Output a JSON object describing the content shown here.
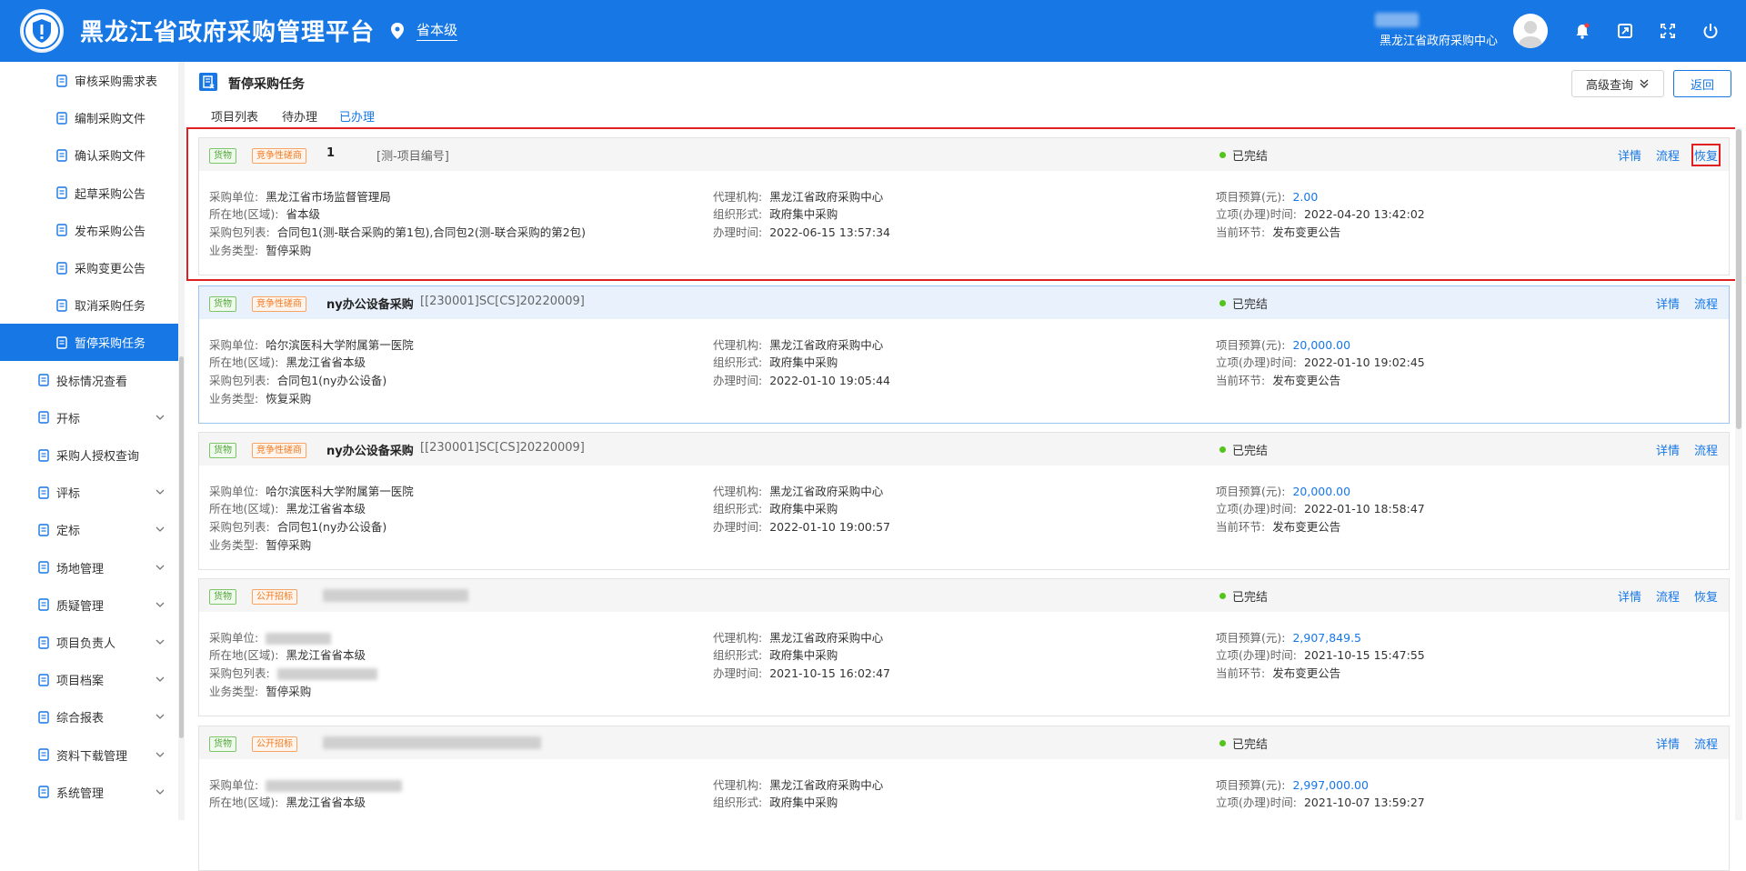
{
  "header": {
    "title": "黑龙江省政府采购管理平台",
    "location": "省本级",
    "user_name": "黑龙江省政府采购中心"
  },
  "colors": {
    "primary": "#1677e5",
    "green": "#52c41a",
    "orange": "#f27a21",
    "highlight": "#e02020"
  },
  "sidebar": {
    "items": [
      {
        "label": "审核采购需求表",
        "icon": "clipboard-check-icon"
      },
      {
        "label": "编制采购文件",
        "icon": "document-icon"
      },
      {
        "label": "确认采购文件",
        "icon": "document-check-icon"
      },
      {
        "label": "起草采购公告",
        "icon": "cart-icon"
      },
      {
        "label": "发布采购公告",
        "icon": "users-icon"
      },
      {
        "label": "采购变更公告",
        "icon": "document-list-icon"
      },
      {
        "label": "取消采购任务",
        "icon": "document-cancel-icon"
      },
      {
        "label": "暂停采购任务",
        "icon": "document-pause-icon"
      },
      {
        "label": "投标情况查看",
        "icon": "view-icon"
      },
      {
        "label": "开标",
        "icon": "gavel-icon"
      },
      {
        "label": "采购人授权查询",
        "icon": "authorize-icon"
      },
      {
        "label": "评标",
        "icon": "evaluate-icon"
      },
      {
        "label": "定标",
        "icon": "award-icon"
      },
      {
        "label": "场地管理",
        "icon": "user-icon"
      },
      {
        "label": "质疑管理",
        "icon": "cart-question-icon"
      },
      {
        "label": "项目负责人",
        "icon": "person-circle-icon"
      },
      {
        "label": "项目档案",
        "icon": "archive-icon"
      },
      {
        "label": "综合报表",
        "icon": "report-icon"
      },
      {
        "label": "资料下载管理",
        "icon": "link-icon"
      },
      {
        "label": "系统管理",
        "icon": "settings-icon"
      }
    ]
  },
  "page": {
    "title": "暂停采购任务",
    "advanced_search": "高级查询",
    "back": "返回",
    "tabs": [
      "项目列表",
      "待办理",
      "已办理"
    ]
  },
  "labels": {
    "purchaser": "采购单位:",
    "region": "所在地(区域):",
    "packages": "采购包列表:",
    "biz_type": "业务类型:",
    "agency": "代理机构:",
    "org_form": "组织形式:",
    "handle_time": "办理时间:",
    "budget": "项目预算(元):",
    "setup_time": "立项(办理)时间:",
    "current_step": "当前环节:",
    "detail": "详情",
    "flow": "流程",
    "restore": "恢复"
  },
  "cards": [
    {
      "category": "货物",
      "method": "竞争性磋商",
      "name": "1",
      "code": "[测-项目编号]",
      "status": "已完结",
      "purchaser": "黑龙江省市场监督管理局",
      "region": "省本级",
      "packages": "合同包1(测-联合采购的第1包),合同包2(测-联合采购的第2包)",
      "biz_type": "暂停采购",
      "agency": "黑龙江省政府采购中心",
      "org_form": "政府集中采购",
      "handle_time": "2022-06-15 13:57:34",
      "budget": "2.00",
      "setup_time": "2022-04-20 13:42:02",
      "current_step": "发布变更公告"
    },
    {
      "category": "货物",
      "method": "竞争性磋商",
      "name": "ny办公设备采购",
      "code": "[[230001]SC[CS]20220009]",
      "status": "已完结",
      "purchaser": "哈尔滨医科大学附属第一医院",
      "region": "黑龙江省省本级",
      "packages": "合同包1(ny办公设备)",
      "biz_type": "恢复采购",
      "agency": "黑龙江省政府采购中心",
      "org_form": "政府集中采购",
      "handle_time": "2022-01-10 19:05:44",
      "budget": "20,000.00",
      "setup_time": "2022-01-10 19:02:45",
      "current_step": "发布变更公告"
    },
    {
      "category": "货物",
      "method": "竞争性磋商",
      "name": "ny办公设备采购",
      "code": "[[230001]SC[CS]20220009]",
      "status": "已完结",
      "purchaser": "哈尔滨医科大学附属第一医院",
      "region": "黑龙江省省本级",
      "packages": "合同包1(ny办公设备)",
      "biz_type": "暂停采购",
      "agency": "黑龙江省政府采购中心",
      "org_form": "政府集中采购",
      "handle_time": "2022-01-10 19:00:57",
      "budget": "20,000.00",
      "setup_time": "2022-01-10 18:58:47",
      "current_step": "发布变更公告"
    },
    {
      "category": "货物",
      "method": "公开招标",
      "status": "已完结",
      "region": "黑龙江省省本级",
      "biz_type": "暂停采购",
      "agency": "黑龙江省政府采购中心",
      "org_form": "政府集中采购",
      "handle_time": "2021-10-15 16:02:47",
      "budget": "2,907,849.5",
      "setup_time": "2021-10-15 15:47:55",
      "current_step": "发布变更公告"
    },
    {
      "category": "货物",
      "method": "公开招标",
      "status": "已完结",
      "region": "黑龙江省省本级",
      "agency": "黑龙江省政府采购中心",
      "org_form": "政府集中采购",
      "budget": "2,997,000.00",
      "setup_time": "2021-10-07 13:59:27"
    }
  ]
}
